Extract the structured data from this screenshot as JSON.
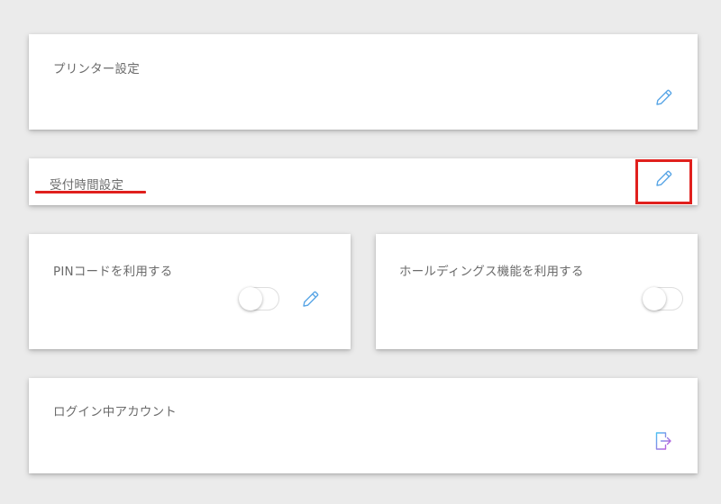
{
  "cards": {
    "printer": {
      "title": "プリンター設定",
      "edit_icon": "pencil-icon"
    },
    "reception_hours": {
      "title": "受付時間設定",
      "edit_icon": "pencil-icon"
    },
    "pin_code": {
      "title": "PINコードを利用する",
      "toggle_on": false,
      "edit_icon": "pencil-icon"
    },
    "holdings": {
      "title": "ホールディングス機能を利用する",
      "toggle_on": false
    },
    "logged_in_account": {
      "title": "ログイン中アカウント",
      "action_icon": "logout-icon"
    }
  },
  "colors": {
    "background": "#ebebeb",
    "card": "#ffffff",
    "title_text": "#6b6b6b",
    "pencil_icon": "#5aa6e6",
    "annotation_red": "#e0201d",
    "logout_gradient": [
      "#4ac1f2",
      "#d24bd8"
    ]
  },
  "annotations": {
    "highlight_box_color": "#e0201d",
    "underline_color": "#e0201d"
  }
}
